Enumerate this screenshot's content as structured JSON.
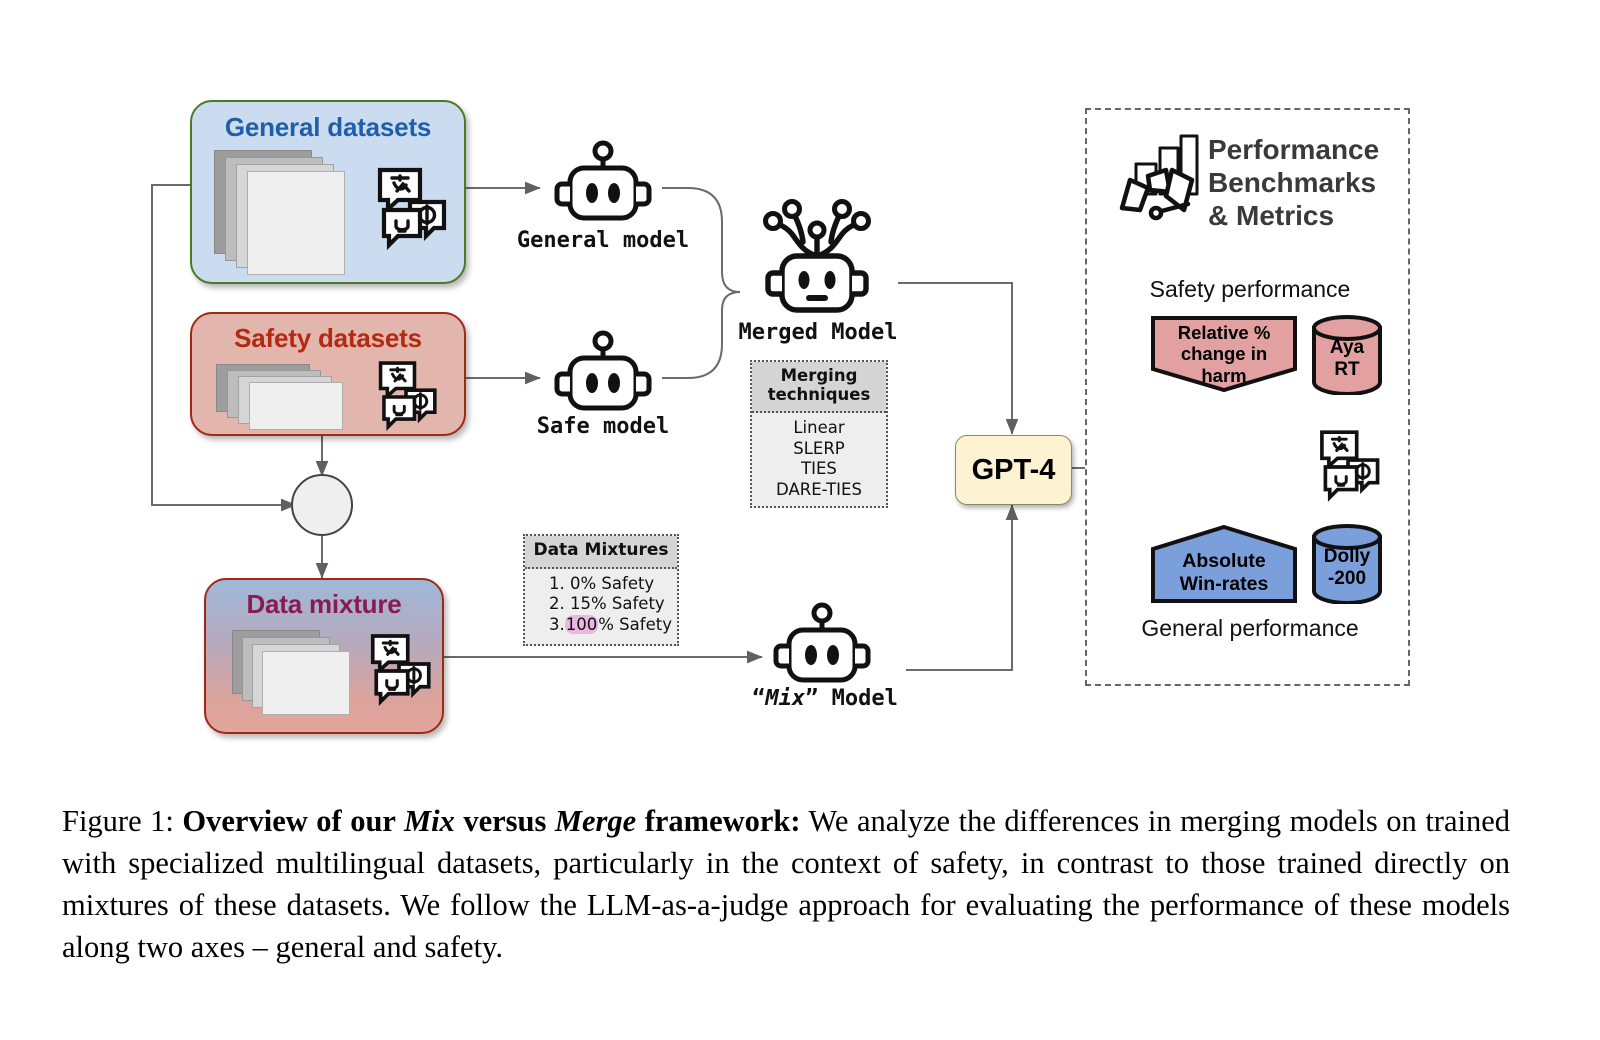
{
  "figure": {
    "caption_prefix": "Figure 1:",
    "caption_bold_1": "Overview of our ",
    "caption_bold_mix": "Mix",
    "caption_bold_2": " versus ",
    "caption_bold_merge": "Merge",
    "caption_bold_3": " framework:",
    "caption_rest": " We analyze the differences in merging models on trained with specialized multilingual datasets, particularly in the context of safety, in contrast to those trained directly on mixtures of these datasets. We follow the LLM-as-a-judge approach for evaluating the performance of these models along two axes – general and safety."
  },
  "colors": {
    "general_card_fill": "#ccdcf0",
    "general_card_border": "#4a7a22",
    "general_title": "#1f5fa9",
    "safety_card_fill": "#e2b6ac",
    "safety_card_border": "#9e2a16",
    "safety_title": "#b22a12",
    "mixture_title": "#8b1a4e",
    "gpt4_fill": "#fdf3d3",
    "harm_fill": "#e2a0a0",
    "winrate_fill": "#7a9fdb",
    "aya_fill": "#e2a0a0",
    "dolly_fill": "#7a9fdb",
    "highlight": "#e9b7e0"
  },
  "inputs": {
    "general": {
      "title": "General datasets",
      "icon": "multilingual-chat-icon",
      "stack_icon": "document-stack-icon"
    },
    "safety": {
      "title": "Safety datasets",
      "icon": "multilingual-chat-icon",
      "stack_icon": "document-stack-icon"
    },
    "mixture": {
      "title": "Data mixture",
      "icon": "multilingual-chat-icon",
      "stack_icon": "document-stack-icon"
    },
    "combine_node": "plus-circle-icon"
  },
  "models": {
    "general_model": "General model",
    "safe_model": "Safe model",
    "merged_model": "Merged Model",
    "mix_model_quote_open": "“",
    "mix_model_name": "Mix",
    "mix_model_quote_close": "”",
    "mix_model_suffix": " Model",
    "robot_icon": "robot-head-icon",
    "merged_robot_icon": "robot-head-network-icon"
  },
  "merging": {
    "header_line1": "Merging",
    "header_line2": "techniques",
    "items": [
      "Linear",
      "SLERP",
      "TIES",
      "DARE-TIES"
    ]
  },
  "data_mixtures": {
    "header": "Data Mixtures",
    "items": [
      {
        "num": "1.",
        "highlight": "",
        "rest": "0% Safety"
      },
      {
        "num": "2.",
        "highlight": "",
        "rest": "15% Safety"
      },
      {
        "num": "3.",
        "highlight": "100",
        "rest": "% Safety"
      }
    ]
  },
  "judge": {
    "label": "GPT-4"
  },
  "evaluation": {
    "heading_line1": "Performance",
    "heading_line2": "Benchmarks",
    "heading_line3": "& Metrics",
    "heading_icon": "gauge-bars-icon",
    "safety_label": "Safety performance",
    "general_label": "General performance",
    "metrics": [
      {
        "name": "harm-metric",
        "line1": "Relative %",
        "line2": "change in",
        "line3": "harm",
        "shape": "pentagon-down"
      },
      {
        "name": "winrate-metric",
        "line1": "Absolute",
        "line2": "Win-rates",
        "line3": "",
        "shape": "pentagon-up"
      }
    ],
    "datasets": [
      {
        "name": "aya-rt-dataset",
        "line1": "Aya",
        "line2": "RT",
        "shape": "cylinder"
      },
      {
        "name": "dolly-200-dataset",
        "line1": "Dolly",
        "line2": "-200",
        "shape": "cylinder"
      }
    ],
    "translation_icon": "multilingual-chat-icon"
  }
}
